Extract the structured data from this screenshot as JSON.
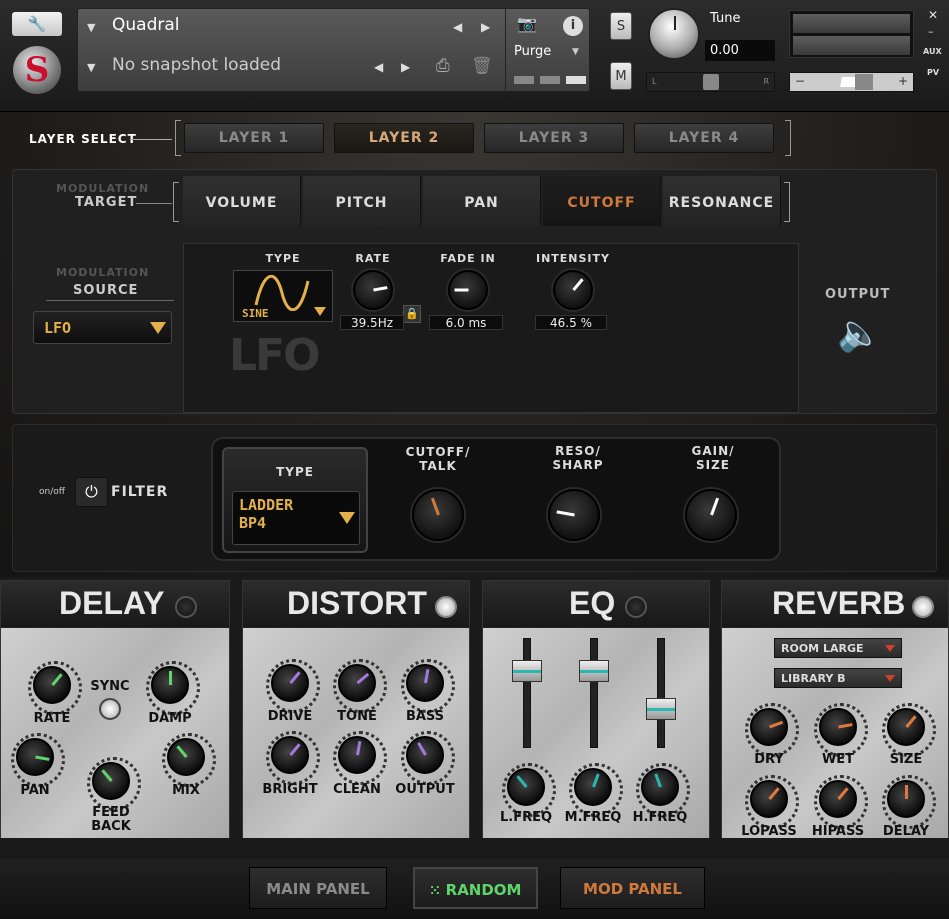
{
  "header": {
    "instrument_name": "Quadral",
    "snapshot": "No snapshot loaded",
    "purge_label": "Purge",
    "solo_label": "S",
    "mute_label": "M",
    "tune_label": "Tune",
    "tune_value": "0.00",
    "pan_left": "L",
    "pan_right": "R",
    "vol_minus": "−",
    "vol_plus": "+",
    "aux_label": "AUX",
    "pv_label": "PV"
  },
  "layers": {
    "label": "LAYER SELECT",
    "items": [
      "LAYER 1",
      "LAYER 2",
      "LAYER 3",
      "LAYER 4"
    ],
    "active": 1
  },
  "modulation": {
    "target_label_top": "MODULATION",
    "target_label": "TARGET",
    "targets": [
      "VOLUME",
      "PITCH",
      "PAN",
      "CUTOFF",
      "RESONANCE"
    ],
    "active_target": 3,
    "source_label_top": "MODULATION",
    "source_label": "SOURCE",
    "source_value": "LFO",
    "type_label": "TYPE",
    "type_value": "SINE",
    "lfo_logo": "LFO",
    "rate_label": "RATE",
    "rate_value": "39.5Hz",
    "fadein_label": "FADE IN",
    "fadein_value": "6.0 ms",
    "intensity_label": "INTENSITY",
    "intensity_value": "46.5 %",
    "output_label": "OUTPUT"
  },
  "filter": {
    "onoff_label": "on/off",
    "label": "FILTER",
    "type_label": "TYPE",
    "type_value_line1": "LADDER",
    "type_value_line2": "BP4",
    "cutoff_label1": "CUTOFF/",
    "cutoff_label2": "TALK",
    "reso_label1": "RESO/",
    "reso_label2": "SHARP",
    "gain_label1": "GAIN/",
    "gain_label2": "SIZE"
  },
  "fx": {
    "delay": {
      "title": "DELAY",
      "rate": "RATE",
      "sync": "SYNC",
      "damp": "DAMP",
      "pan": "PAN",
      "feedback1": "FEED",
      "feedback2": "BACK",
      "mix": "MIX"
    },
    "distort": {
      "title": "DISTORT",
      "drive": "DRIVE",
      "tone": "TONE",
      "bass": "BASS",
      "bright": "BRIGHT",
      "clean": "CLEAN",
      "output": "OUTPUT"
    },
    "eq": {
      "title": "EQ",
      "lfreq": "L.FREQ",
      "mfreq": "M.FREQ",
      "hfreq": "H.FREQ"
    },
    "reverb": {
      "title": "REVERB",
      "room": "ROOM LARGE",
      "library": "LIBRARY B",
      "dry": "DRY",
      "wet": "WET",
      "size": "SIZE",
      "lopass": "LOPASS",
      "hipass": "HIPASS",
      "delay": "DELAY"
    }
  },
  "bottom": {
    "main_panel": "MAIN PANEL",
    "random": "RANDOM",
    "mod_panel": "MOD PANEL"
  },
  "colors": {
    "accent_orange": "#d07a3a",
    "accent_yellow": "#e3b04a",
    "delay_ind": "#5fd46a",
    "distort_ind": "#a27ae0",
    "eq_ind": "#2ab7b0",
    "reverb_ind": "#e07a3a"
  }
}
